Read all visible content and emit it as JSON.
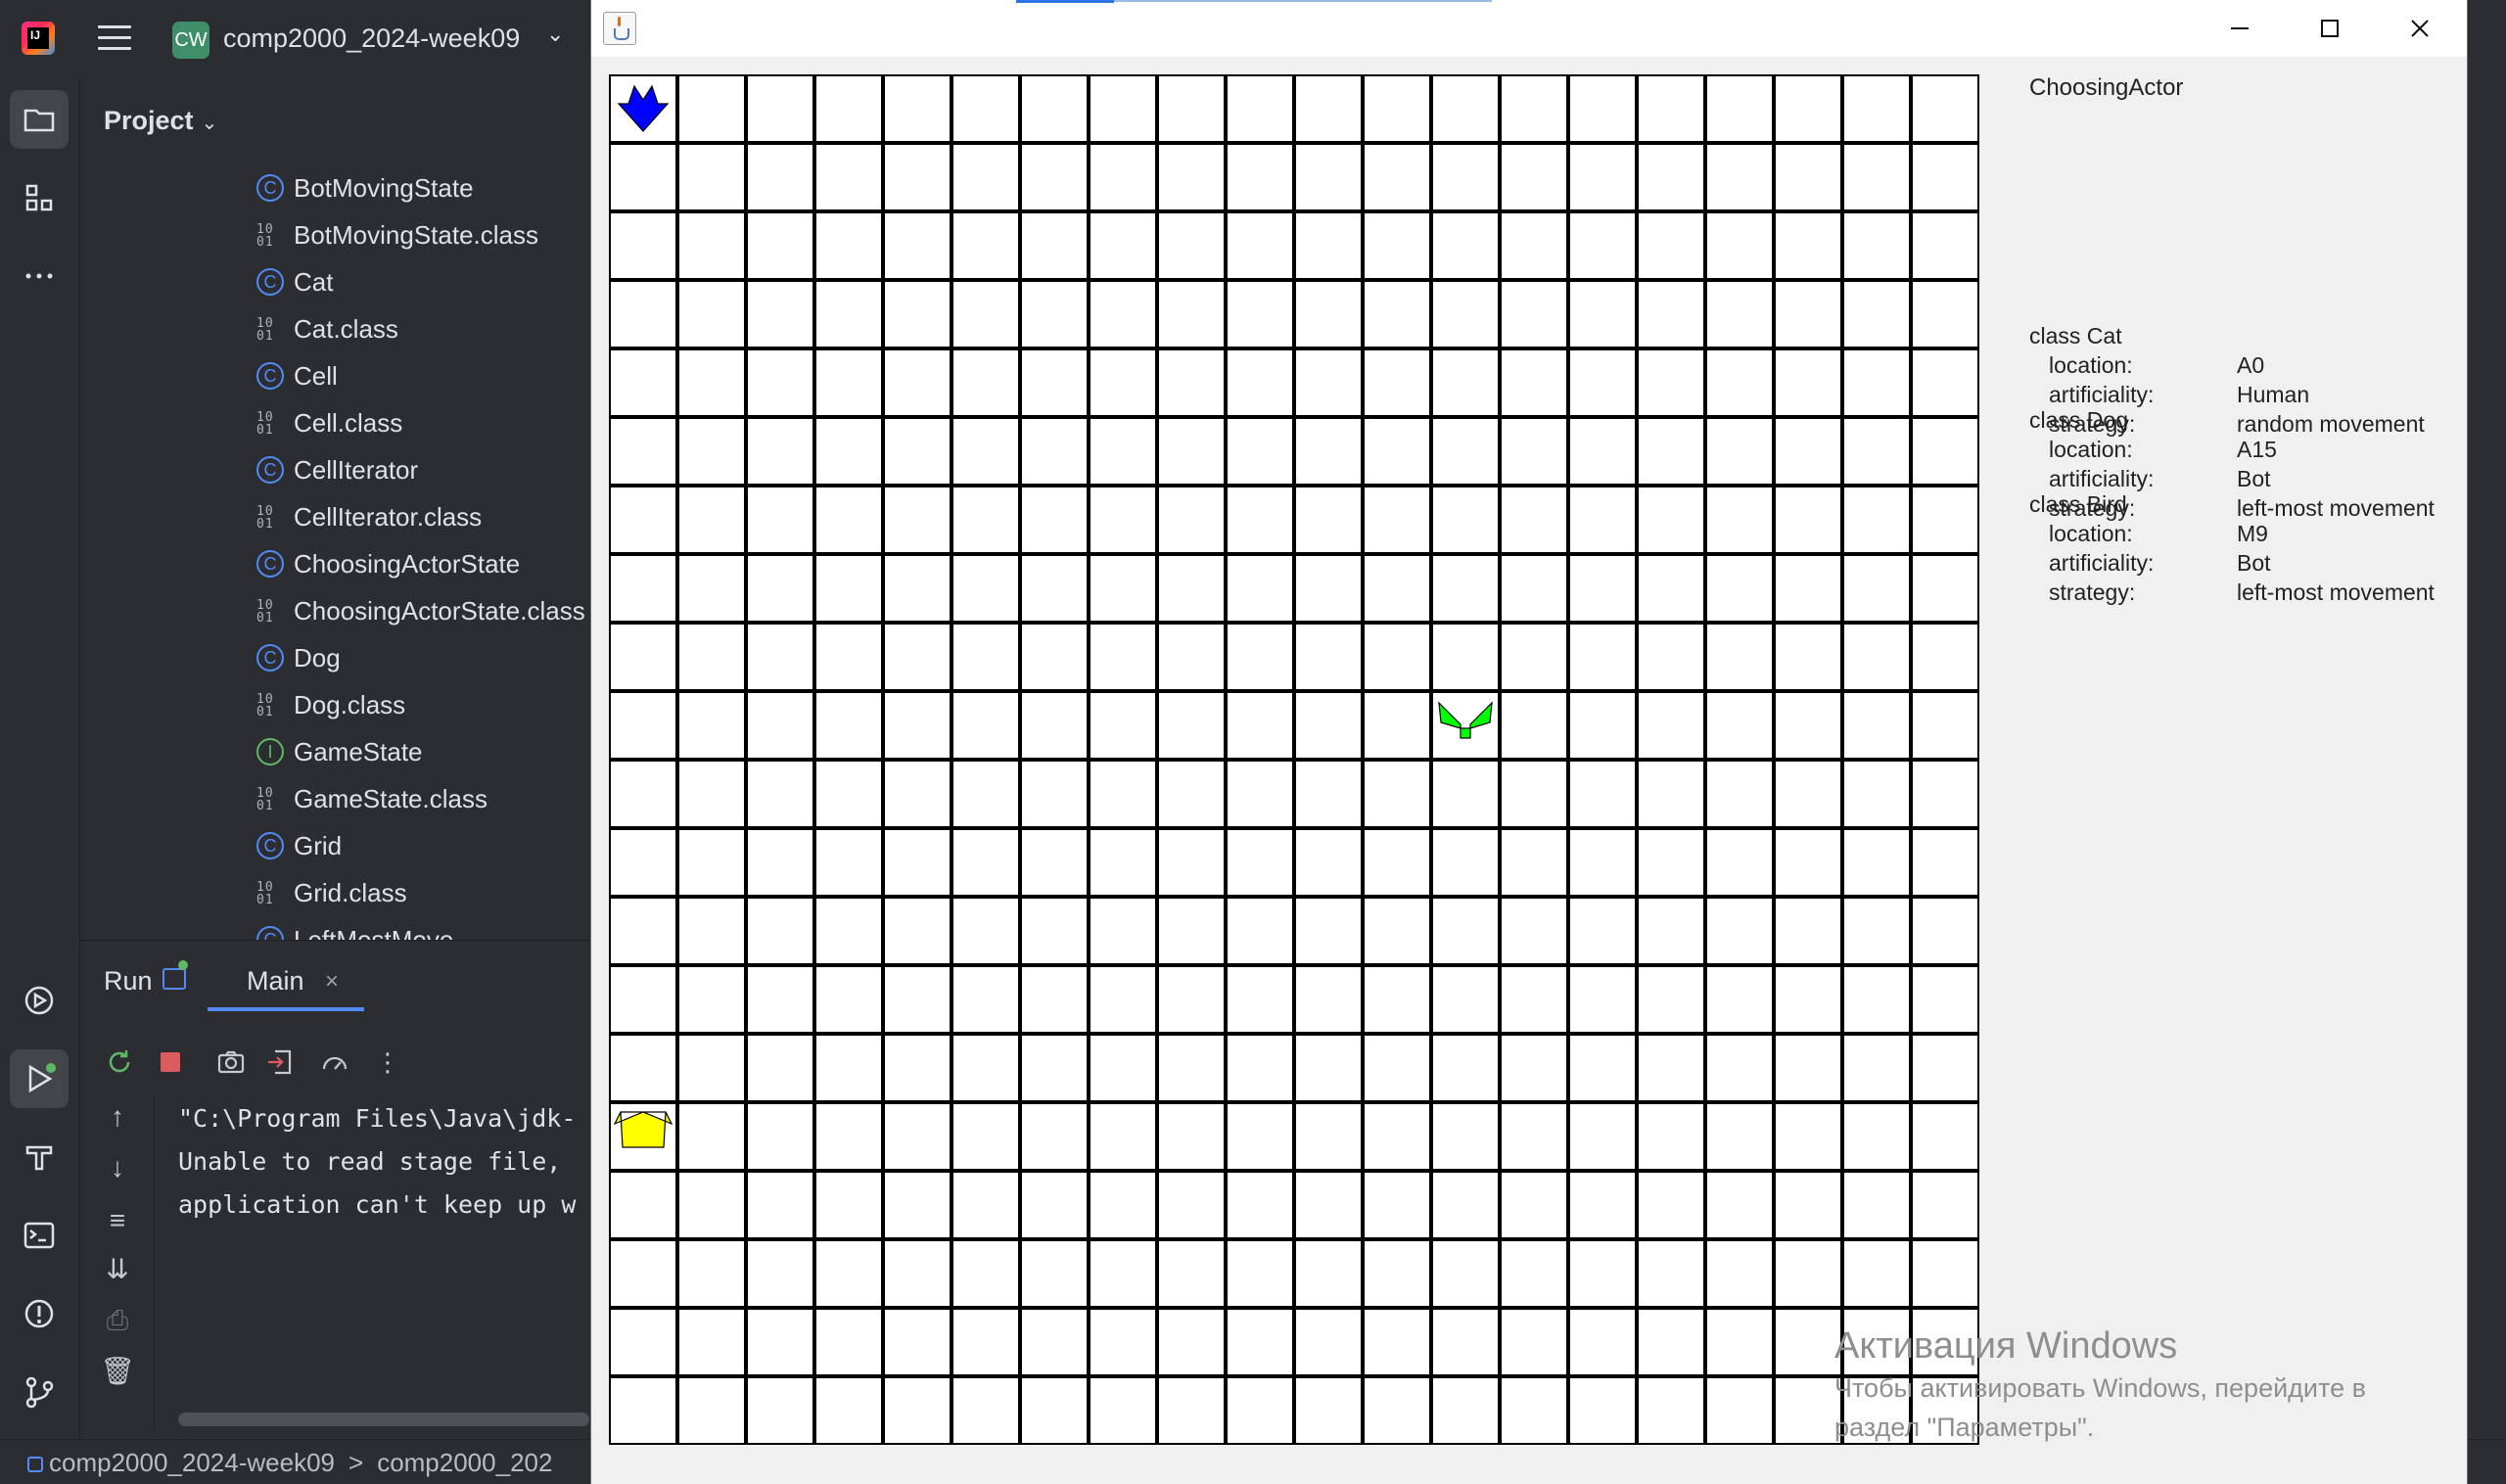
{
  "ide": {
    "project_badge": "CW",
    "project_name": "comp2000_2024-week09",
    "panel_title": "Project",
    "tree_items": [
      {
        "label": "BotMovingState",
        "kind": "class"
      },
      {
        "label": "BotMovingState.class",
        "kind": "binary"
      },
      {
        "label": "Cat",
        "kind": "class"
      },
      {
        "label": "Cat.class",
        "kind": "binary"
      },
      {
        "label": "Cell",
        "kind": "class"
      },
      {
        "label": "Cell.class",
        "kind": "binary"
      },
      {
        "label": "CellIterator",
        "kind": "class"
      },
      {
        "label": "CellIterator.class",
        "kind": "binary"
      },
      {
        "label": "ChoosingActorState",
        "kind": "class"
      },
      {
        "label": "ChoosingActorState.class",
        "kind": "binary"
      },
      {
        "label": "Dog",
        "kind": "class"
      },
      {
        "label": "Dog.class",
        "kind": "binary"
      },
      {
        "label": "GameState",
        "kind": "interface"
      },
      {
        "label": "GameState.class",
        "kind": "binary"
      },
      {
        "label": "Grid",
        "kind": "class"
      },
      {
        "label": "Grid.class",
        "kind": "binary"
      },
      {
        "label": "LeftMostMove",
        "kind": "class"
      }
    ],
    "class_icon_glyph": "C",
    "interface_icon_glyph": "I",
    "binary_icon_glyph": "10\n01",
    "run": {
      "title": "Run",
      "tab_label": "Main",
      "tab_close": "×",
      "console_lines": [
        "\"C:\\Program Files\\Java\\jdk-",
        "Unable to read stage file,",
        "application can't keep up w"
      ]
    },
    "statusbar": {
      "project": "comp2000_2024-week09",
      "separator": ">",
      "module": "comp2000_202"
    }
  },
  "app": {
    "state_label": "ChoosingActor",
    "actors": [
      {
        "title": "class Cat",
        "location": "A0",
        "artificiality": "Human",
        "strategy": "random movement",
        "color": "#ffff00",
        "col": 0,
        "row": 15
      },
      {
        "title": "class Dog",
        "location": "A15",
        "artificiality": "Bot",
        "strategy": "left-most movement",
        "color": "#0000ff",
        "col": 0,
        "row": 0
      },
      {
        "title": "class Bird",
        "location": "M9",
        "artificiality": "Bot",
        "strategy": "left-most movement",
        "color": "#00ff00",
        "col": 12,
        "row": 9
      }
    ],
    "labels": {
      "location": "location:",
      "artificiality": "artificiality:",
      "strategy": "strategy:"
    },
    "grid": {
      "columns": 20,
      "rows": 20,
      "line_color": "#000000",
      "cell_color": "#ffffff"
    }
  },
  "activation": {
    "title": "Активация Windows",
    "line1": "Чтобы активировать Windows, перейдите в",
    "line2": "раздел \"Параметры\"."
  },
  "colors": {
    "ide_bg": "#2b2d30",
    "accent": "#548af7",
    "project_badge": "#3f8e6a"
  }
}
